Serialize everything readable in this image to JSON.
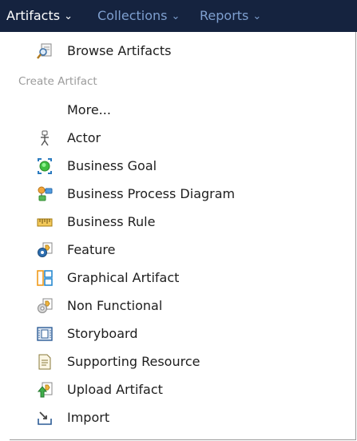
{
  "nav": {
    "artifacts_label": "Artifacts",
    "collections_label": "Collections",
    "reports_label": "Reports"
  },
  "menu": {
    "browse_label": "Browse Artifacts",
    "section_header": "Create Artifact",
    "more_label": "More...",
    "items": [
      {
        "label": "Actor",
        "icon": "actor-icon"
      },
      {
        "label": "Business Goal",
        "icon": "business-goal-icon"
      },
      {
        "label": "Business Process Diagram",
        "icon": "business-process-diagram-icon"
      },
      {
        "label": "Business Rule",
        "icon": "business-rule-icon"
      },
      {
        "label": "Feature",
        "icon": "feature-icon"
      },
      {
        "label": "Graphical Artifact",
        "icon": "graphical-artifact-icon"
      },
      {
        "label": "Non Functional",
        "icon": "non-functional-icon"
      },
      {
        "label": "Storyboard",
        "icon": "storyboard-icon"
      },
      {
        "label": "Supporting Resource",
        "icon": "supporting-resource-icon"
      },
      {
        "label": "Upload Artifact",
        "icon": "upload-artifact-icon"
      },
      {
        "label": "Import",
        "icon": "import-icon"
      }
    ]
  },
  "colors": {
    "topbar_bg": "#15233f",
    "nav_active": "#ffffff",
    "nav_inactive": "#7e9fcf",
    "section_header": "#9b9b9b"
  }
}
